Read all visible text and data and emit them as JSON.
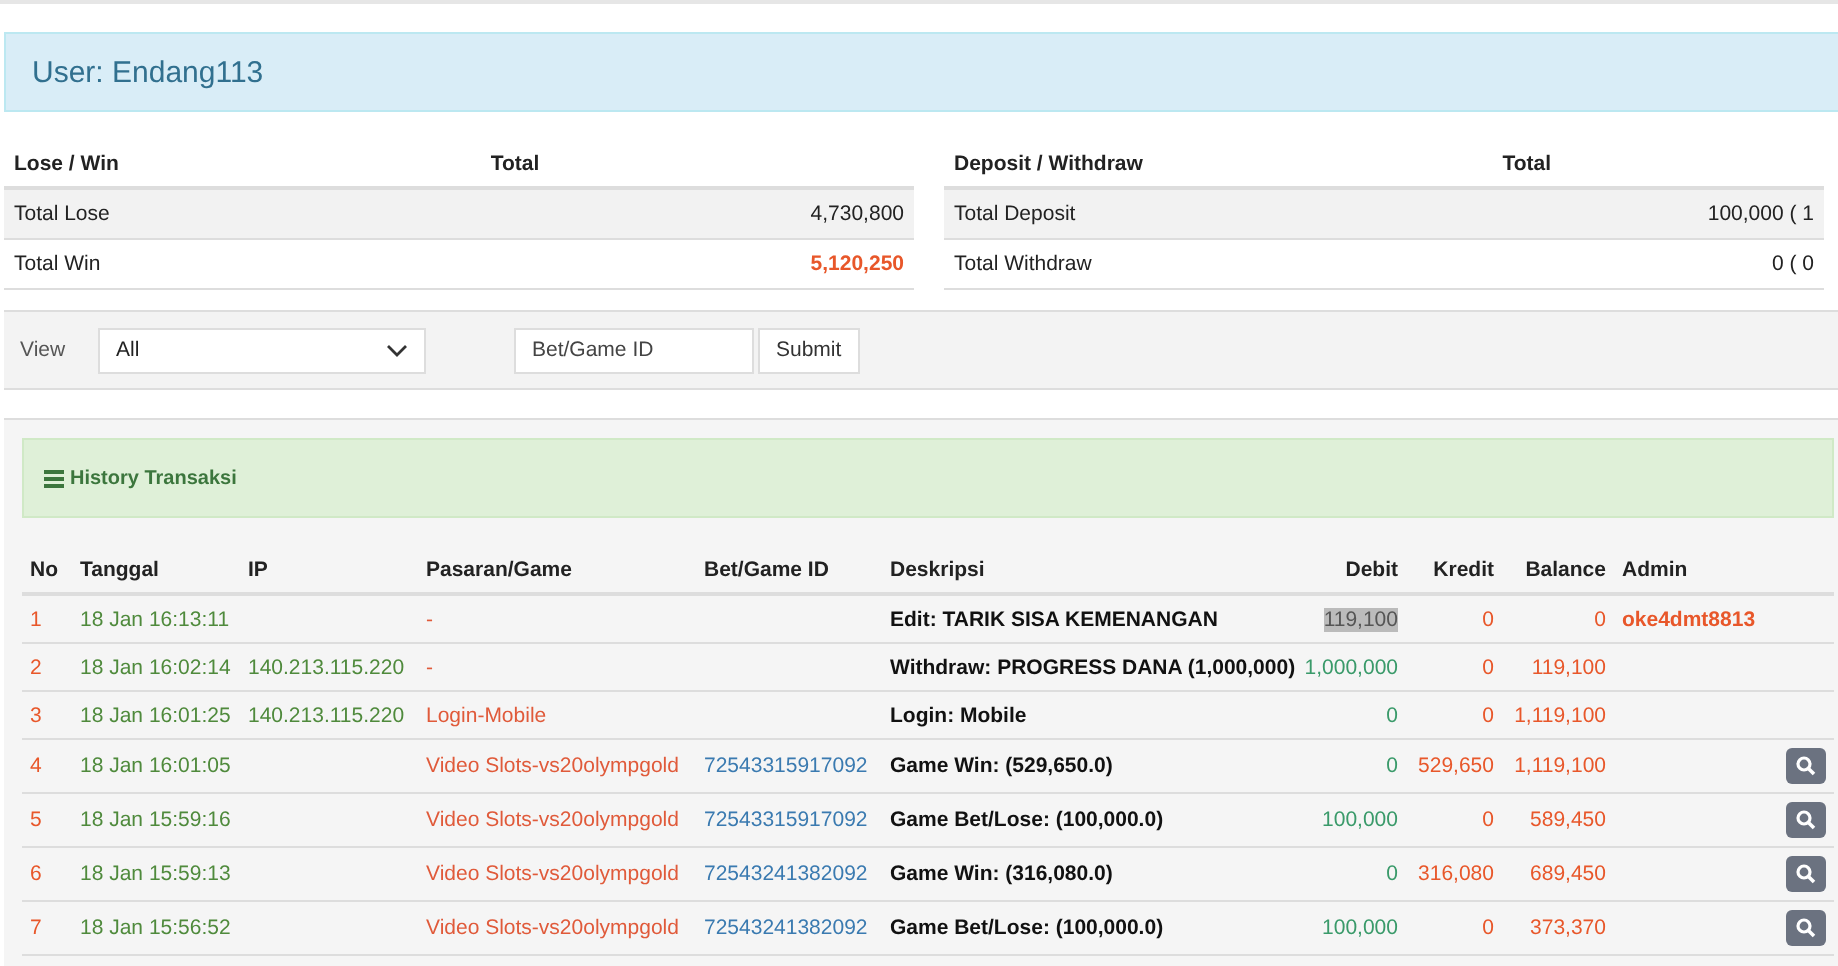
{
  "user_header": {
    "title": "User: Endang113"
  },
  "lose_win": {
    "columns": [
      "Lose / Win",
      "Total"
    ],
    "rows": [
      {
        "label": "Total Lose",
        "value": "4,730,800",
        "kind": "plain"
      },
      {
        "label": "Total Win",
        "value": "5,120,250",
        "kind": "accent"
      }
    ]
  },
  "deposit_withdraw": {
    "columns": [
      "Deposit / Withdraw",
      "Total"
    ],
    "rows": [
      {
        "label": "Total Deposit",
        "value": "100,000 ( 1",
        "kind": "plain"
      },
      {
        "label": "Total Withdraw",
        "value": "0 ( 0",
        "kind": "plain"
      }
    ]
  },
  "filter": {
    "label": "View",
    "select_value": "All",
    "id_placeholder": "Bet/Game ID",
    "submit": "Submit"
  },
  "history": {
    "title": "History Transaksi",
    "columns": [
      "No",
      "Tanggal",
      "IP",
      "Pasaran/Game",
      "Bet/Game ID",
      "Deskripsi",
      "Debit",
      "Kredit",
      "Balance",
      "Admin"
    ],
    "rows": [
      {
        "no": "1",
        "date": "18 Jan 16:13:11",
        "ip": "",
        "game": "-",
        "bet_id": "",
        "description": "Edit: TARIK SISA KEMENANGAN",
        "debit": "119,100",
        "debit_highlighted": true,
        "kredit": "0",
        "balance": "0",
        "admin": "oke4dmt8813",
        "detail_button": false
      },
      {
        "no": "2",
        "date": "18 Jan 16:02:14",
        "ip": "140.213.115.220",
        "game": "-",
        "bet_id": "",
        "description": "Withdraw: PROGRESS DANA (1,000,000)",
        "debit": "1,000,000",
        "debit_highlighted": false,
        "kredit": "0",
        "balance": "119,100",
        "admin": "",
        "detail_button": false
      },
      {
        "no": "3",
        "date": "18 Jan 16:01:25",
        "ip": "140.213.115.220",
        "game": "Login-Mobile",
        "bet_id": "",
        "description": "Login: Mobile",
        "debit": "0",
        "debit_highlighted": false,
        "kredit": "0",
        "balance": "1,119,100",
        "admin": "",
        "detail_button": false
      },
      {
        "no": "4",
        "date": "18 Jan 16:01:05",
        "ip": "",
        "game": "Video Slots-vs20olympgold",
        "bet_id": "72543315917092",
        "description": "Game Win: (529,650.0)",
        "debit": "0",
        "debit_highlighted": false,
        "kredit": "529,650",
        "balance": "1,119,100",
        "admin": "",
        "detail_button": true
      },
      {
        "no": "5",
        "date": "18 Jan 15:59:16",
        "ip": "",
        "game": "Video Slots-vs20olympgold",
        "bet_id": "72543315917092",
        "description": "Game Bet/Lose: (100,000.0)",
        "debit": "100,000",
        "debit_highlighted": false,
        "kredit": "0",
        "balance": "589,450",
        "admin": "",
        "detail_button": true
      },
      {
        "no": "6",
        "date": "18 Jan 15:59:13",
        "ip": "",
        "game": "Video Slots-vs20olympgold",
        "bet_id": "72543241382092",
        "description": "Game Win: (316,080.0)",
        "debit": "0",
        "debit_highlighted": false,
        "kredit": "316,080",
        "balance": "689,450",
        "admin": "",
        "detail_button": true
      },
      {
        "no": "7",
        "date": "18 Jan 15:56:52",
        "ip": "",
        "game": "Video Slots-vs20olympgold",
        "bet_id": "72543241382092",
        "description": "Game Bet/Lose: (100,000.0)",
        "debit": "100,000",
        "debit_highlighted": false,
        "kredit": "0",
        "balance": "373,370",
        "admin": "",
        "detail_button": true
      }
    ]
  }
}
